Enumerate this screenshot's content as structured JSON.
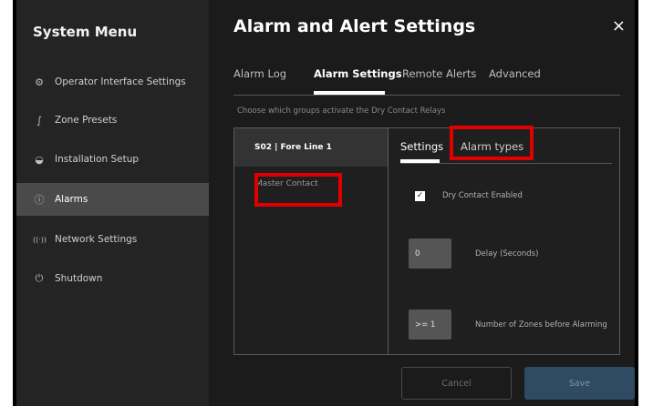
{
  "sidebar": {
    "title": "System Menu",
    "items": [
      {
        "icon": "gear-icon",
        "glyph": "⚙",
        "label": "Operator Interface Settings"
      },
      {
        "icon": "zone-icon",
        "glyph": "∫",
        "label": "Zone Presets"
      },
      {
        "icon": "install-icon",
        "glyph": "◒",
        "label": "Installation Setup"
      },
      {
        "icon": "alarm-icon",
        "glyph": "ⓘ",
        "label": "Alarms",
        "active": true
      },
      {
        "icon": "network-icon",
        "glyph": "((·))",
        "label": "Network Settings"
      },
      {
        "icon": "power-icon",
        "glyph": "⏻",
        "label": "Shutdown"
      }
    ]
  },
  "main": {
    "title": "Alarm and Alert Settings",
    "close_glyph": "×",
    "tabs": [
      {
        "label": "Alarm Log"
      },
      {
        "label": "Alarm Settings",
        "active": true
      },
      {
        "label": "Remote Alerts"
      },
      {
        "label": "Advanced"
      }
    ],
    "hint": "Choose which groups activate the Dry Contact Relays"
  },
  "groups": {
    "header": "S02 | Fore Line 1",
    "item": "Master Contact"
  },
  "settings": {
    "sub_tabs": [
      {
        "label": "Settings",
        "active": true
      },
      {
        "label": "Alarm types"
      }
    ],
    "checkbox_mark": "✓",
    "checkbox_label": "Dry Contact Enabled",
    "checkbox_checked": true,
    "delay_value": "0",
    "delay_label": "Delay (Seconds)",
    "zones_value": ">= 1",
    "zones_label": "Number of Zones before Alarming"
  },
  "buttons": {
    "cancel": "Cancel",
    "save": "Save"
  },
  "highlight_color": "#e00000"
}
